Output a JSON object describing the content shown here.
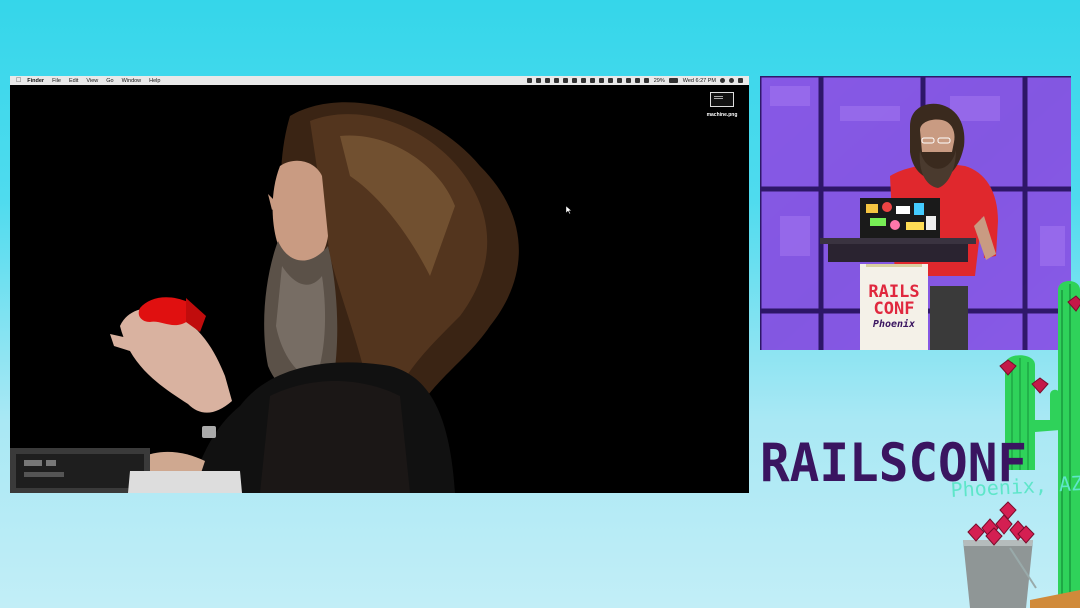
{
  "menubar": {
    "app_name": "Finder",
    "menus": [
      "File",
      "Edit",
      "View",
      "Go",
      "Window",
      "Help"
    ],
    "battery": "29%",
    "clock": "Wed 6:27 PM"
  },
  "desktop": {
    "file_name": "machine.png"
  },
  "podium_sign": {
    "line1": "RAILS",
    "line2": "CONF",
    "line3": "Phoenix"
  },
  "branding": {
    "title": "RAILSCONF",
    "location": "Phoenix, AZ"
  },
  "colors": {
    "background_top": "#35d6ea",
    "background_bottom": "#c2eef7",
    "brand_purple": "#3a1560",
    "brand_teal": "#5ee6c9",
    "cactus_green": "#2fd25a",
    "ruby_red": "#c41848",
    "shirt_red": "#e0282d"
  }
}
